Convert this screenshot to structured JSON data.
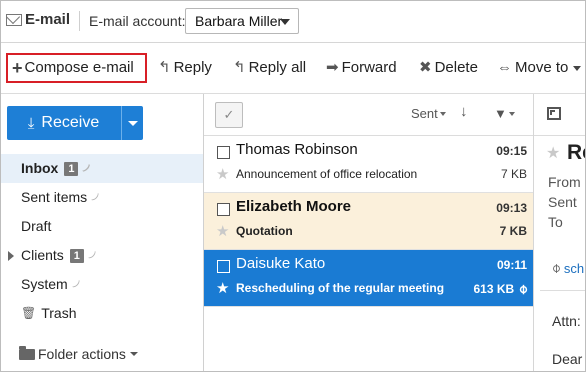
{
  "header": {
    "app_title": "E-mail",
    "account_label": "E-mail account:",
    "account_value": "Barbara Miller"
  },
  "toolbar": {
    "compose": "Compose e-mail",
    "reply": "Reply",
    "reply_all": "Reply all",
    "forward": "Forward",
    "delete": "Delete",
    "move_to": "Move to"
  },
  "sidebar": {
    "receive": "Receive",
    "folders": [
      {
        "label": "Inbox",
        "badge": "1"
      },
      {
        "label": "Sent items",
        "badge": ""
      },
      {
        "label": "Draft",
        "badge": ""
      },
      {
        "label": "Clients",
        "badge": "1"
      },
      {
        "label": "System",
        "badge": ""
      },
      {
        "label": "Trash",
        "badge": ""
      }
    ],
    "folder_actions": "Folder actions"
  },
  "list": {
    "sort_label": "Sent",
    "rows": [
      {
        "sender": "Thomas Robinson",
        "time": "09:15",
        "subject": "Announcement of office relocation",
        "size": "7 KB"
      },
      {
        "sender": "Elizabeth Moore",
        "time": "09:13",
        "subject": "Quotation",
        "size": "7 KB"
      },
      {
        "sender": "Daisuke Kato",
        "time": "09:11",
        "subject": "Rescheduling of the regular meeting",
        "size": "613 KB"
      }
    ]
  },
  "preview": {
    "title": "Re",
    "from_label": "From",
    "sent_label": "Sent",
    "to_label": "To",
    "attachment": "sch",
    "attn": "Attn:",
    "dear": "Dear"
  },
  "colors": {
    "accent": "#1e7fd6",
    "selected_row": "#1a7bd3",
    "unread_row": "#fbf0db",
    "active_folder": "#e7f0f9",
    "highlight_border": "#d81f26"
  }
}
